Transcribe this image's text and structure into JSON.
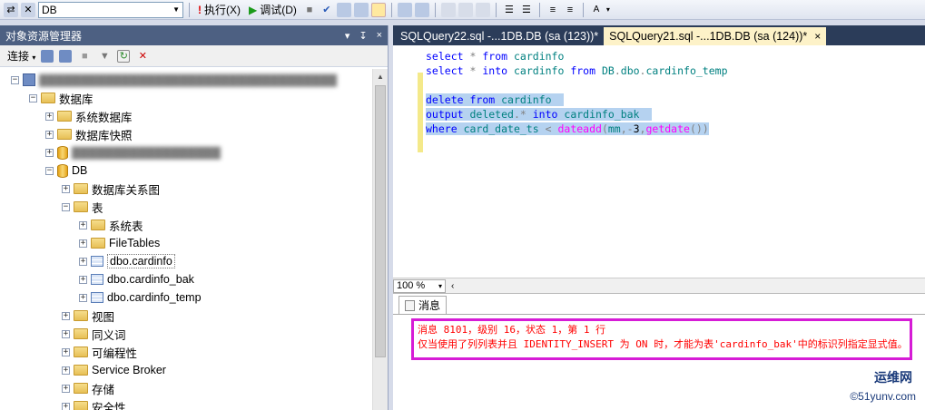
{
  "toolbar": {
    "database": "DB",
    "execute_label": "执行(X)",
    "debug_label": "调试(D)"
  },
  "object_explorer": {
    "title": "对象资源管理器",
    "title_controls": [
      "▾",
      "↧",
      "×"
    ],
    "connect_label": "连接",
    "tree": [
      {
        "label": "数据库"
      },
      {
        "label": "系统数据库"
      },
      {
        "label": "数据库快照"
      },
      {
        "label": "DB"
      },
      {
        "label": "数据库关系图"
      },
      {
        "label": "表"
      },
      {
        "label": "系统表"
      },
      {
        "label": "FileTables"
      },
      {
        "label": "dbo.cardinfo"
      },
      {
        "label": "dbo.cardinfo_bak"
      },
      {
        "label": "dbo.cardinfo_temp"
      },
      {
        "label": "视图"
      },
      {
        "label": "同义词"
      },
      {
        "label": "可编程性"
      },
      {
        "label": "Service Broker"
      },
      {
        "label": "存储"
      },
      {
        "label": "安全性"
      }
    ]
  },
  "tabs": [
    {
      "label": "SQLQuery22.sql -...1DB.DB (sa (123))*"
    },
    {
      "label": "SQLQuery21.sql -...1DB.DB (sa (124))*",
      "close": "×"
    }
  ],
  "editor": {
    "zoom": "100 %"
  },
  "results": {
    "tab_label": "消息",
    "line1": "消息 8101，级别 16，状态 1，第 1 行",
    "line2": "仅当使用了列列表并且 IDENTITY_INSERT 为 ON 时，才能为表'cardinfo_bak'中的标识列指定显式值。"
  },
  "watermark": {
    "brand": "运维网",
    "site": "©51yunv.com"
  }
}
